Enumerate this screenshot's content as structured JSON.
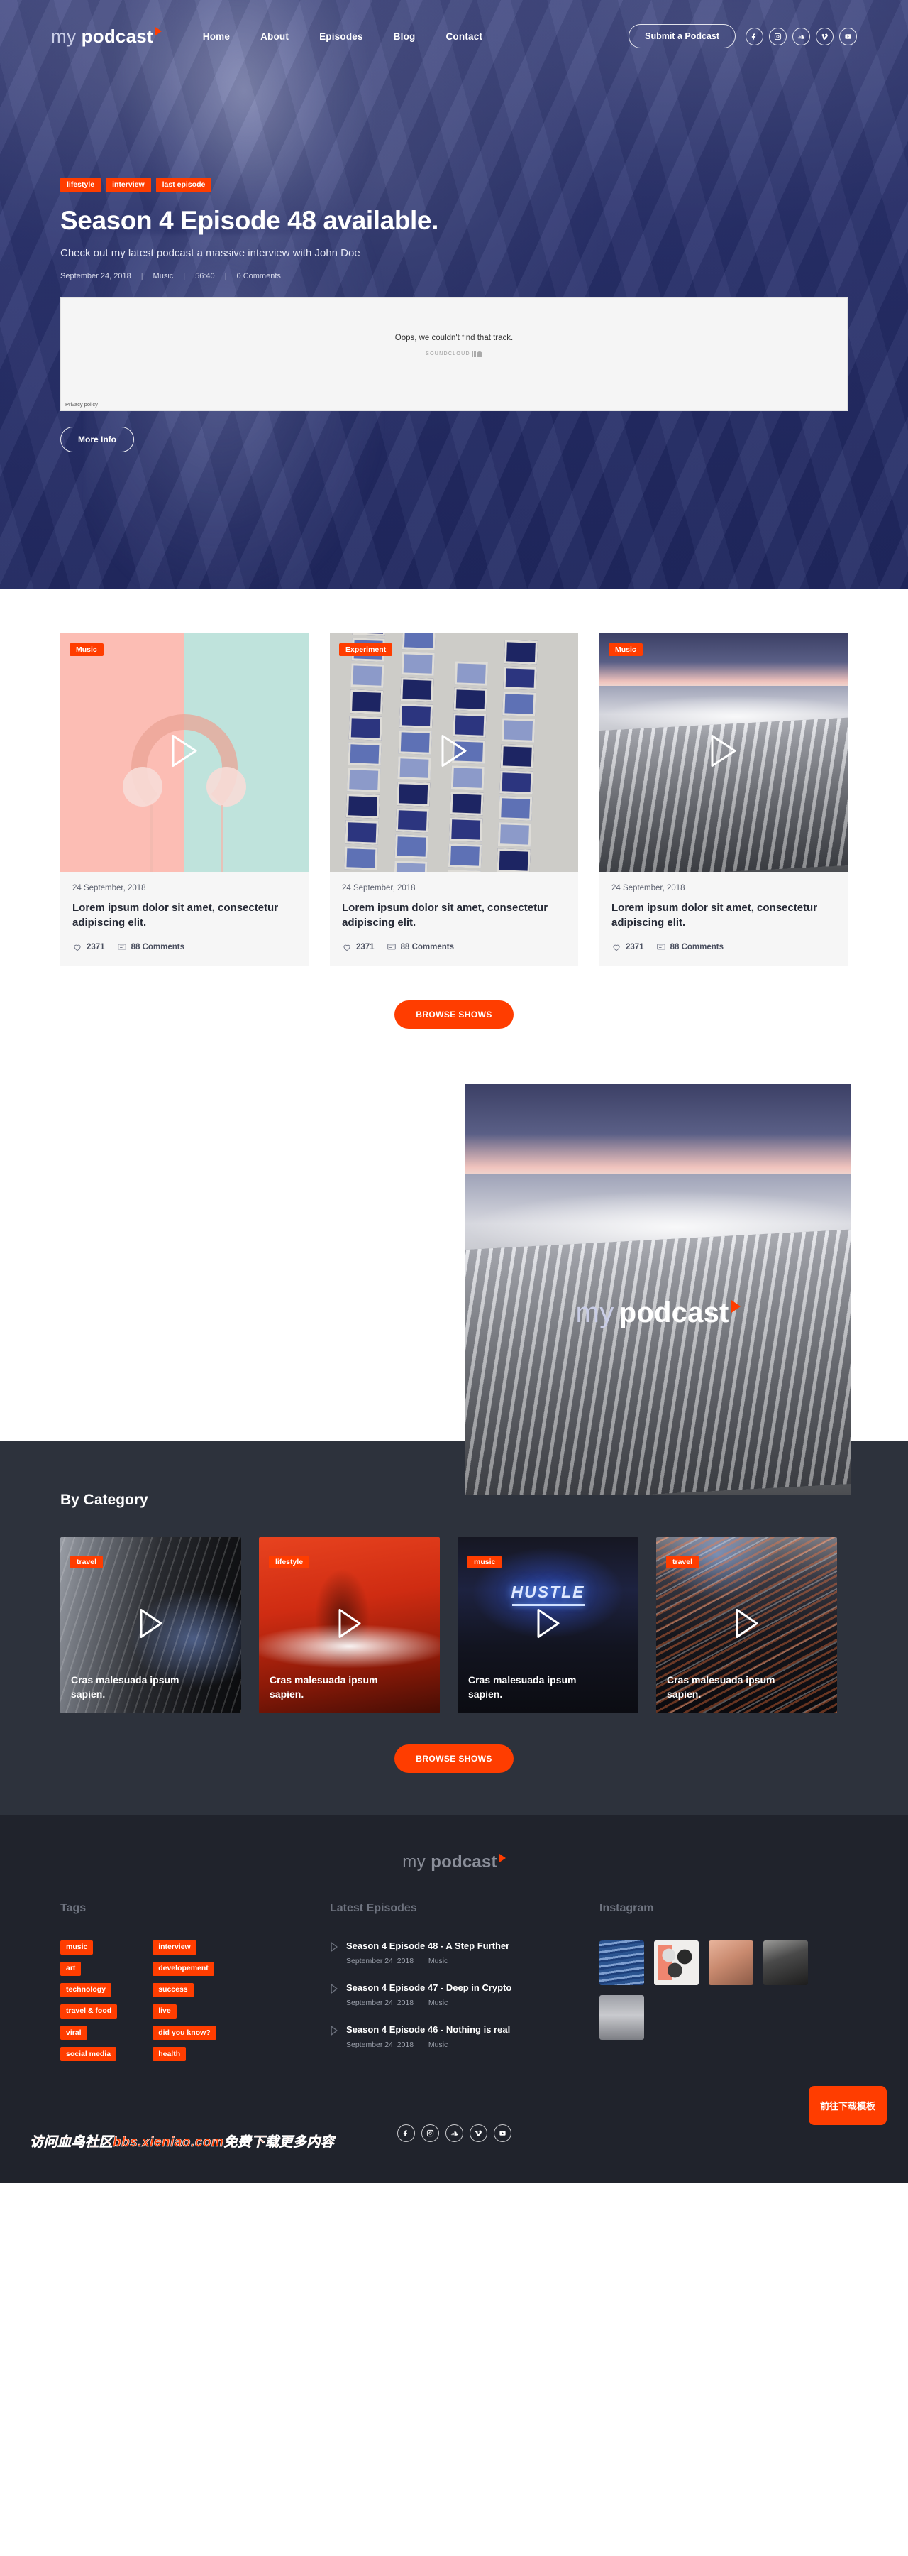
{
  "brand": {
    "part1": "my",
    "part2": "podcast",
    "play_icon": "play-triangle-icon"
  },
  "nav": {
    "links": [
      {
        "label": "Home"
      },
      {
        "label": "About"
      },
      {
        "label": "Episodes"
      },
      {
        "label": "Blog"
      },
      {
        "label": "Contact"
      }
    ],
    "submit_label": "Submit a Podcast",
    "socials": [
      {
        "name": "facebook-icon"
      },
      {
        "name": "instagram-icon"
      },
      {
        "name": "soundcloud-icon"
      },
      {
        "name": "vimeo-icon"
      },
      {
        "name": "youtube-icon"
      }
    ]
  },
  "hero": {
    "chips": [
      {
        "label": "lifestyle"
      },
      {
        "label": "interview"
      },
      {
        "label": "last episode"
      }
    ],
    "title": "Season 4 Episode 48 available.",
    "subtitle": "Check out my latest podcast a massive interview with John Doe",
    "meta": {
      "date": "September 24, 2018",
      "category": "Music",
      "duration": "56:40",
      "comments": "0 Comments"
    },
    "embed": {
      "message": "Oops, we couldn't find that track.",
      "brand": "SOUNDCLOUD",
      "privacy": "Privacy policy"
    },
    "more_info_label": "More Info"
  },
  "episodes": {
    "cards": [
      {
        "tag": "Music",
        "date": "24 September, 2018",
        "title": "Lorem ipsum dolor sit amet, consectetur adipiscing elit.",
        "likes": "2371",
        "comments": "88 Comments",
        "art": "headphones"
      },
      {
        "tag": "Experiment",
        "date": "24 September, 2018",
        "title": "Lorem ipsum dolor sit amet, consectetur adipiscing elit.",
        "likes": "2371",
        "comments": "88 Comments",
        "art": "building"
      },
      {
        "tag": "Music",
        "date": "24 September, 2018",
        "title": "Lorem ipsum dolor sit amet, consectetur adipiscing elit.",
        "likes": "2371",
        "comments": "88 Comments",
        "art": "wave"
      }
    ],
    "browse_label": "BROWSE SHOWS"
  },
  "feature": {
    "logo_part1": "my",
    "logo_part2": "podcast"
  },
  "bycategory": {
    "heading": "By Category",
    "cards": [
      {
        "tag": "travel",
        "title": "Cras malesuada ipsum sapien.",
        "art": "tunnel"
      },
      {
        "tag": "lifestyle",
        "title": "Cras malesuada ipsum sapien.",
        "art": "hand"
      },
      {
        "tag": "music",
        "title": "Cras malesuada ipsum sapien.",
        "art": "hustle",
        "art_text": "HUSTLE"
      },
      {
        "tag": "travel",
        "title": "Cras malesuada ipsum sapien.",
        "art": "city"
      }
    ],
    "browse_label": "BROWSE SHOWS"
  },
  "footer": {
    "tags_heading": "Tags",
    "tags_col1": [
      {
        "label": "music"
      },
      {
        "label": "art"
      },
      {
        "label": "technology"
      },
      {
        "label": "travel & food"
      },
      {
        "label": "viral"
      },
      {
        "label": "social media"
      }
    ],
    "tags_col2": [
      {
        "label": "interview"
      },
      {
        "label": "developement"
      },
      {
        "label": "success"
      },
      {
        "label": "live"
      },
      {
        "label": "did you know?"
      },
      {
        "label": "health"
      }
    ],
    "episodes_heading": "Latest Episodes",
    "episodes": [
      {
        "title": "Season 4 Episode 48 - A Step Further",
        "date": "September 24, 2018",
        "category": "Music"
      },
      {
        "title": "Season 4 Episode 47 - Deep in Crypto",
        "date": "September 24, 2018",
        "category": "Music"
      },
      {
        "title": "Season 4 Episode 46 - Nothing is real",
        "date": "September 24, 2018",
        "category": "Music"
      }
    ],
    "instagram_heading": "Instagram",
    "socials": [
      {
        "name": "facebook-icon"
      },
      {
        "name": "instagram-icon"
      },
      {
        "name": "soundcloud-icon"
      },
      {
        "name": "vimeo-icon"
      },
      {
        "name": "youtube-icon"
      }
    ],
    "watermark": "访问血鸟社区bbs.xieniao.com免费下载更多内容",
    "download_label": "前往下载模板"
  },
  "colors": {
    "accent": "#ff3d00",
    "hero_bg": "#2a3270",
    "dark_section": "#2d323c",
    "footer_bg": "#20232c"
  }
}
